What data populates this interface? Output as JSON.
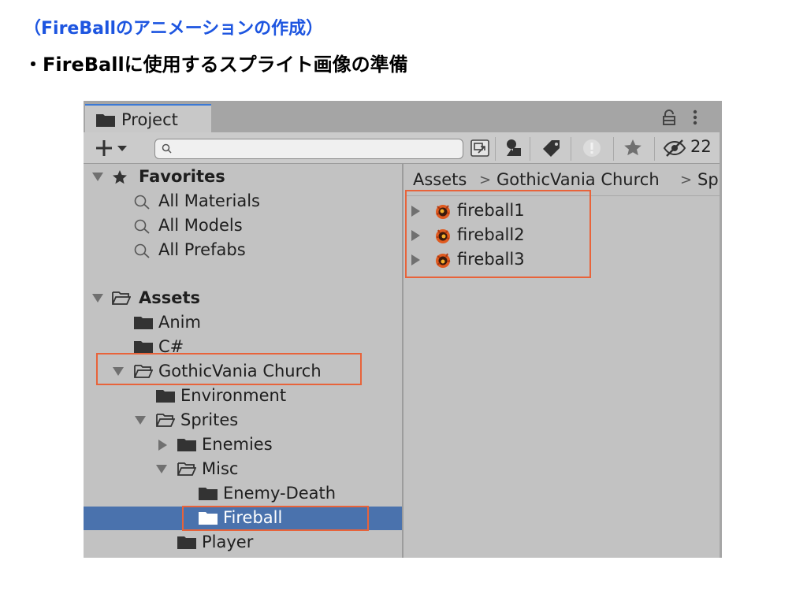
{
  "slide": {
    "title": "（FireBallのアニメーションの作成）",
    "bullet": "・FireBallに使用するスプライト画像の準備"
  },
  "window": {
    "tab_label": "Project",
    "search": {
      "value": "",
      "placeholder": ""
    },
    "hidden_count": "22"
  },
  "tree": {
    "favorites": {
      "label": "Favorites",
      "items": [
        "All Materials",
        "All Models",
        "All Prefabs"
      ]
    },
    "assets": {
      "label": "Assets",
      "anim": "Anim",
      "csharp": "C#",
      "gothicvania": "GothicVania Church",
      "environment": "Environment",
      "sprites": "Sprites",
      "enemies": "Enemies",
      "misc": "Misc",
      "enemy_death": "Enemy-Death",
      "fireball": "Fireball",
      "player": "Player"
    }
  },
  "breadcrumb": {
    "items": [
      "Assets",
      "GothicVania Church",
      "Sp"
    ],
    "separator": ">"
  },
  "assets_list": [
    "fireball1",
    "fireball2",
    "fireball3"
  ],
  "colors": {
    "title_blue": "#1d55e0",
    "selection_blue": "#4a72ad",
    "highlight_orange": "#e8633a",
    "tab_accent": "#3a79d6"
  }
}
